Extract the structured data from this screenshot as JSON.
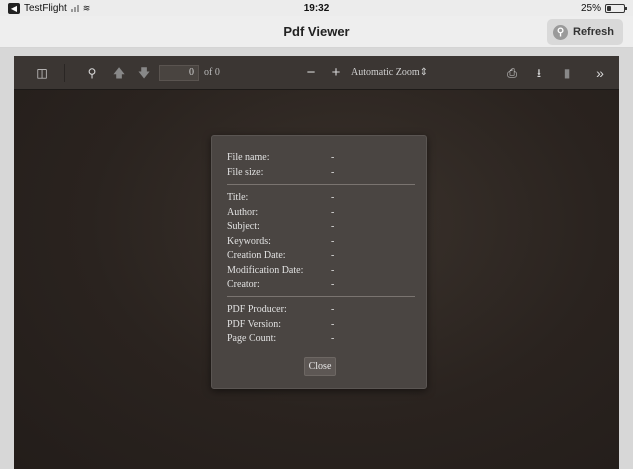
{
  "status_bar": {
    "app_back": "TestFlight",
    "time": "19:32",
    "battery": "25%",
    "battery_level": 0.25
  },
  "nav": {
    "title": "Pdf Viewer",
    "refresh_label": "Refresh"
  },
  "toolbar": {
    "page_number": "0",
    "page_of": "of 0",
    "zoom": "Automatic Zoom",
    "icons": [
      "sidebar-toggle-icon",
      "search-icon",
      "previous-page-icon",
      "next-page-icon",
      "zoom-out-icon",
      "zoom-in-icon",
      "print-icon",
      "download-icon",
      "bookmark-icon",
      "tools-icon"
    ]
  },
  "dialog": {
    "file_rows": [
      {
        "label": "File name:",
        "value": "-"
      },
      {
        "label": "File size:",
        "value": "-"
      }
    ],
    "meta_rows": [
      {
        "label": "Title:",
        "value": "-"
      },
      {
        "label": "Author:",
        "value": "-"
      },
      {
        "label": "Subject:",
        "value": "-"
      },
      {
        "label": "Keywords:",
        "value": "-"
      },
      {
        "label": "Creation Date:",
        "value": "-"
      },
      {
        "label": "Modification Date:",
        "value": "-"
      },
      {
        "label": "Creator:",
        "value": "-"
      }
    ],
    "pdf_rows": [
      {
        "label": "PDF Producer:",
        "value": "-"
      },
      {
        "label": "PDF Version:",
        "value": "-"
      },
      {
        "label": "Page Count:",
        "value": "-"
      }
    ],
    "close_label": "Close"
  }
}
